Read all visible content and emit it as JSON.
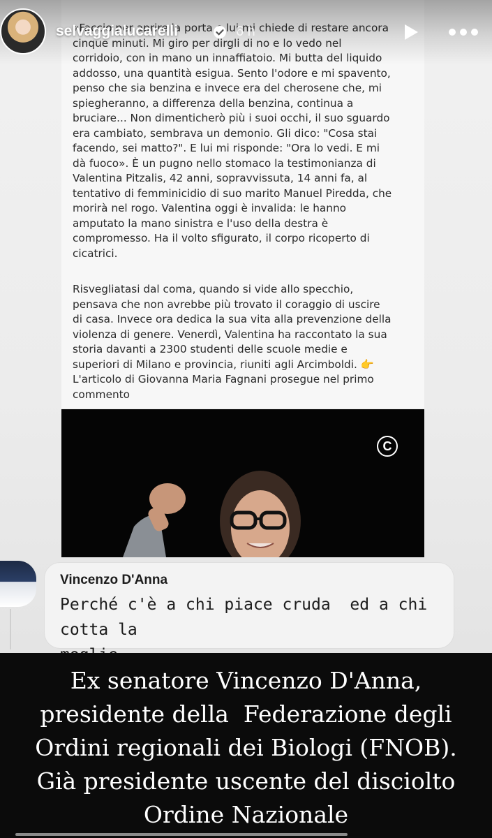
{
  "story": {
    "username": "selvaggialucarelli",
    "timestamp": "6 h",
    "icons": {
      "verified": "verified-badge-icon",
      "play": "play-icon",
      "more": "more-options-icon",
      "copyright": "copyright-c-icon"
    }
  },
  "post": {
    "paragraph1": "«Faccio per aprire la porta e lui mi chiede di restare ancora\ncinque minuti. Mi giro per dirgli di no e lo vedo nel\ncorridoio, con in mano un innaffiatoio. Mi butta del liquido\naddosso, una quantità esigua. Sento l'odore e mi spavento,\npenso che sia benzina e invece era del cherosene che, mi\nspiegheranno, a differenza della benzina, continua a\nbruciare... Non dimenticherò più i suoi occhi, il suo sguardo\nera cambiato, sembrava un demonio. Gli dico: \"Cosa stai\nfacendo, sei matto?\". E lui mi risponde: \"Ora lo vedi. E mi\ndà fuoco». È un pugno nello stomaco la testimonianza di\nValentina Pitzalis, 42 anni, sopravvissuta, 14 anni fa, al\ntentativo di femminicidio di suo marito Manuel Piredda, che\nmorirà nel rogo. Valentina oggi è invalida: le hanno\namputato la mano sinistra e l'uso della destra è\ncompromesso. Ha il volto sfigurato, il corpo ricoperto di\ncicatrici.",
    "paragraph2": "Risvegliatasi dal coma, quando si vide allo specchio,\npensava che non avrebbe più trovato il coraggio di uscire\ndi casa. Invece ora dedica la sua vita alla prevenzione della\nviolenza di genere. Venerdì, Valentina ha raccontato la sua\nstoria davanti a 2300 studenti delle scuole medie e\nsuperiori di Milano e provincia, riuniti agli Arcimboldi. 👉\nL'articolo di Giovanna Maria Fagnani prosegue nel primo\ncommento",
    "photo_badge": "C"
  },
  "comment": {
    "author": "Vincenzo D'Anna",
    "text": "Perché c'è a chi piace cruda  ed a chi cotta la\nmoglie ."
  },
  "caption": {
    "text": "Ex senatore Vincenzo D'Anna,\npresidente della  Federazione degli\nOrdini regionali dei Biologi (FNOB).\nGià presidente uscente del disciolto\nOrdine Nazionale"
  }
}
